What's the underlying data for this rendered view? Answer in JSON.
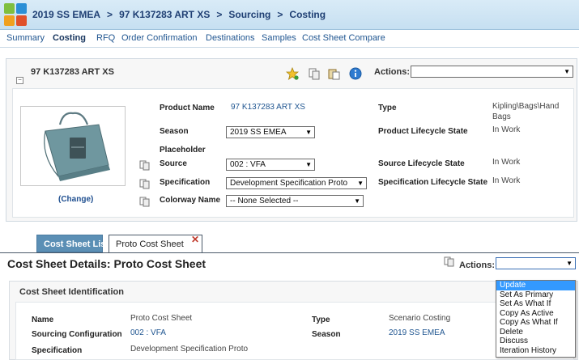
{
  "header": {
    "breadcrumb": [
      "2019 SS EMEA",
      "97 K137283 ART XS",
      "Sourcing",
      "Costing"
    ],
    "logo_colors": [
      "#7fbf3f",
      "#2b8fd6",
      "#f0a020",
      "#e0502a"
    ]
  },
  "nav": {
    "items": [
      "Summary",
      "Costing",
      "RFQ",
      "Order Confirmation",
      "Destinations",
      "Samples",
      "Cost Sheet Compare"
    ],
    "active": "Costing"
  },
  "product": {
    "title": "97 K137283 ART XS",
    "collapse_glyph": "−",
    "actions_label": "Actions:",
    "actions_value": "",
    "change_link": "(Change)",
    "fields": {
      "product_name_label": "Product Name",
      "product_name_value": "97 K137283 ART XS",
      "season_label": "Season",
      "season_value": "2019 SS EMEA",
      "placeholder_label": "Placeholder",
      "source_label": "Source",
      "source_value": "002 : VFA",
      "specification_label": "Specification",
      "specification_value": "Development Specification Proto",
      "colorway_label": "Colorway Name",
      "colorway_value": "-- None Selected --",
      "type_label": "Type",
      "type_value_line1": "Kipling\\Bags\\Hand",
      "type_value_line2": "Bags",
      "plc_label": "Product Lifecycle State",
      "plc_value": "In Work",
      "slc_label": "Source Lifecycle State",
      "slc_value": "In Work",
      "speclc_label": "Specification Lifecycle State",
      "speclc_value": "In Work"
    },
    "icons": [
      "favorite-star-icon",
      "copy-icon",
      "paste-icon",
      "info-icon"
    ]
  },
  "tabs": {
    "inactive_label": "Cost Sheet List",
    "active_label": "Proto Cost Sheet",
    "close_glyph": "✕"
  },
  "cost_sheet": {
    "title": "Cost Sheet Details: Proto Cost Sheet",
    "actions_label": "Actions:",
    "actions_value": "",
    "section_label": "Cost Sheet Identification",
    "fields": {
      "name_label": "Name",
      "name_value": "Proto Cost Sheet",
      "sourcing_label": "Sourcing Configuration",
      "sourcing_value": "002 : VFA",
      "spec_label": "Specification",
      "spec_value": "Development Specification Proto",
      "type_label": "Type",
      "type_value": "Scenario Costing",
      "season_label": "Season",
      "season_value": "2019 SS EMEA"
    },
    "menu_items": [
      "Update",
      "Set As Primary",
      "Set As What If",
      "Copy As Active",
      "Copy As What If",
      "Delete",
      "Discuss",
      "Iteration History"
    ],
    "menu_highlighted": "Update"
  },
  "colors": {
    "header_bg": "#c6dff1",
    "link": "#1f5590",
    "tab_inactive": "#5b8fb5",
    "menu_highlight": "#3399ff"
  }
}
